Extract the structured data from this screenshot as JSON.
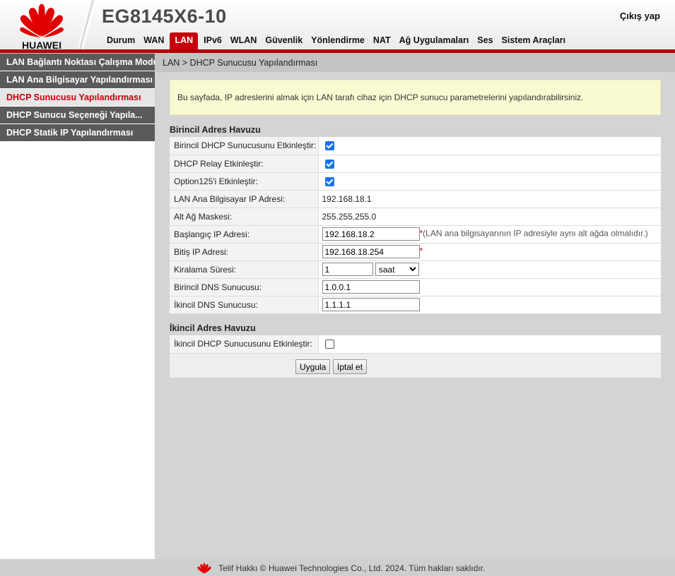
{
  "brand": {
    "logo_text": "HUAWEI",
    "accent": "#c7000b"
  },
  "header": {
    "device_title": "EG8145X6-10",
    "logout": "Çıkış yap",
    "tabs": [
      {
        "label": "Durum"
      },
      {
        "label": "WAN"
      },
      {
        "label": "LAN",
        "active": true
      },
      {
        "label": "IPv6"
      },
      {
        "label": "WLAN"
      },
      {
        "label": "Güvenlik"
      },
      {
        "label": "Yönlendirme"
      },
      {
        "label": "NAT"
      },
      {
        "label": "Ağ Uygulamaları"
      },
      {
        "label": "Ses"
      },
      {
        "label": "Sistem Araçları"
      }
    ]
  },
  "sidebar": {
    "items": [
      {
        "label": "LAN Bağlantı Noktası Çalışma Modu"
      },
      {
        "label": "LAN Ana Bilgisayar Yapılandırması"
      },
      {
        "label": "DHCP Sunucusu Yapılandırması",
        "active": true
      },
      {
        "label": "DHCP Sunucu Seçeneği Yapıla..."
      },
      {
        "label": "DHCP Statik IP Yapılandırması"
      }
    ]
  },
  "main": {
    "breadcrumb": "LAN > DHCP Sunucusu Yapılandırması",
    "info": "Bu sayfada, IP adreslerini almak için LAN tarafı cihaz için DHCP sunucu parametrelerini yapılandırabilirsiniz.",
    "primary": {
      "title": "Birincil Adres Havuzu",
      "enable_label": "Birincil DHCP Sunucusunu Etkinleştir:",
      "enable_checked": true,
      "relay_label": "DHCP Relay Etkinleştir:",
      "relay_checked": true,
      "option125_label": "Option125'i Etkinleştir:",
      "option125_checked": true,
      "host_ip_label": "LAN Ana Bilgisayar IP Adresi:",
      "host_ip": "192.168.18.1",
      "mask_label": "Alt Ağ Maskesi:",
      "mask": "255.255.255.0",
      "start_ip_label": "Başlangıç IP Adresi:",
      "start_ip": "192.168.18.2",
      "start_ip_required": "*",
      "start_ip_hint": "(LAN ana bilgisayarının IP adresiyle aynı alt ağda olmalıdır.)",
      "end_ip_label": "Bitiş IP Adresi:",
      "end_ip": "192.168.18.254",
      "end_ip_required": "*",
      "lease_label": "Kiralama Süresi:",
      "lease_value": "1",
      "lease_unit": "saat",
      "dns1_label": "Birincil DNS Sunucusu:",
      "dns1": "1.0.0.1",
      "dns2_label": "İkincil DNS Sunucusu:",
      "dns2": "1.1.1.1"
    },
    "secondary": {
      "title": "İkincil Adres Havuzu",
      "enable_label": "İkincil DHCP Sunucusunu Etkinleştir:",
      "enable_checked": false
    },
    "buttons": {
      "apply": "Uygula",
      "cancel": "İptal et"
    }
  },
  "footer": {
    "copyright": "Telif Hakkı © Huawei Technologies Co., Ltd. 2024. Tüm hakları saklıdır."
  }
}
